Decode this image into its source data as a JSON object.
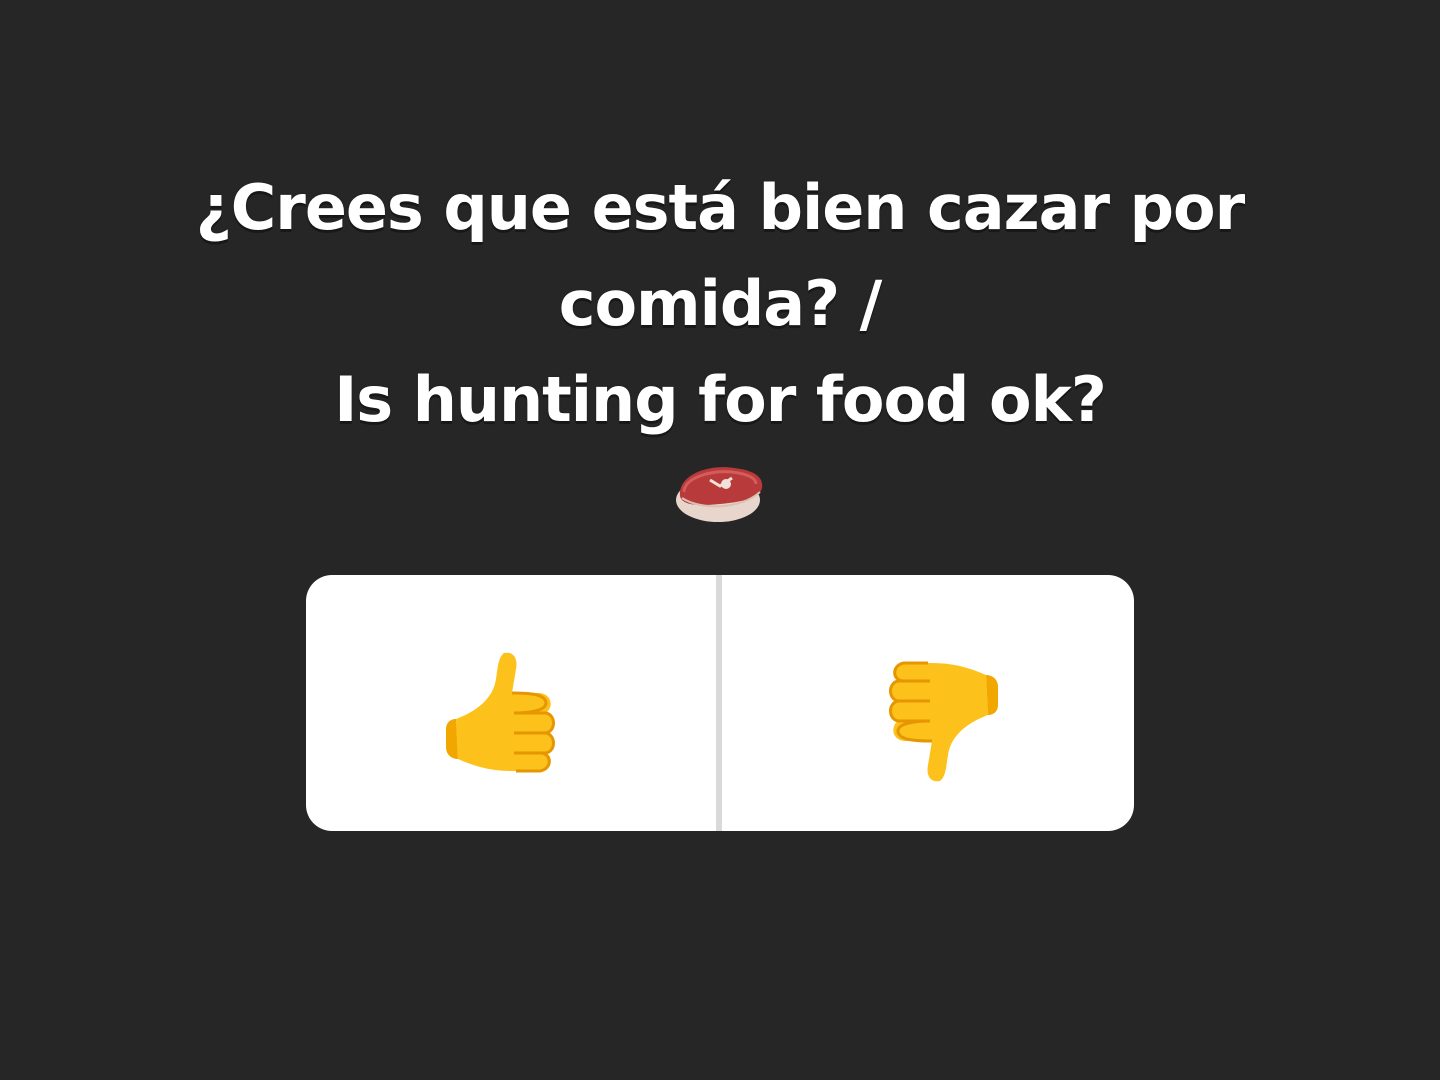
{
  "question": {
    "line1": "¿Crees que está bien cazar por",
    "line2": "comida? /",
    "line3": "Is hunting for food ok?",
    "emoji": "steak-icon"
  },
  "poll": {
    "options": [
      {
        "icon": "thumbs-up-icon"
      },
      {
        "icon": "thumbs-down-icon"
      }
    ]
  },
  "colors": {
    "background": "#262626",
    "card": "#ffffff",
    "divider": "#d9d9d9",
    "text": "#ffffff",
    "thumb": "#fcc21b"
  }
}
